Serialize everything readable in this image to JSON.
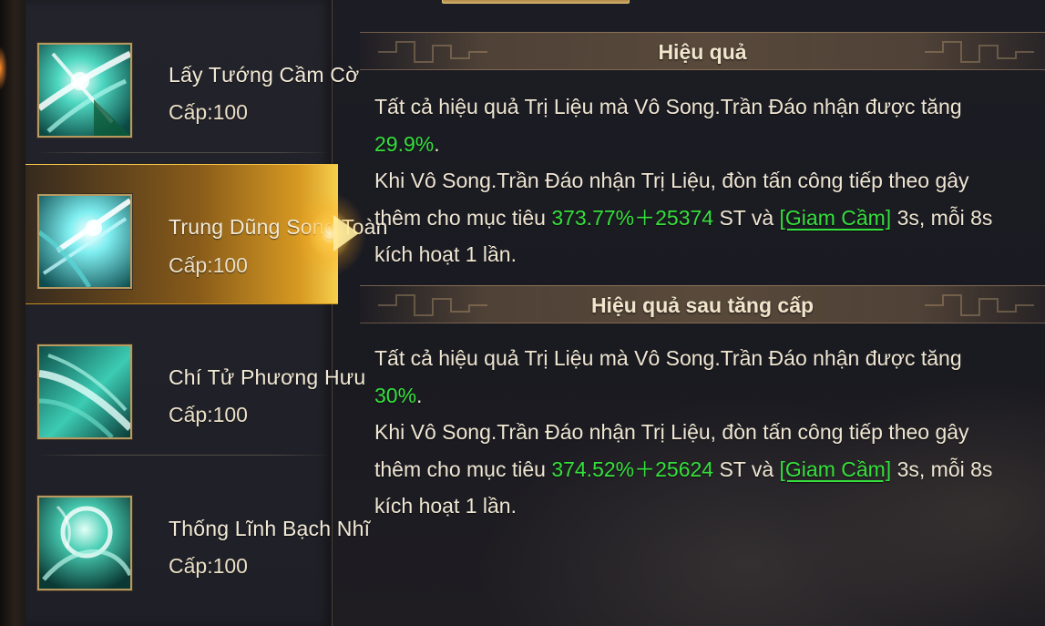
{
  "skills": [
    {
      "name": "Lấy Tướng Cầm Cờ",
      "level": "Cấp:100",
      "icon": "green-slash-icon",
      "selected": false
    },
    {
      "name": "Trung Dũng Song Toàn",
      "level": "Cấp:100",
      "icon": "ice-strike-icon",
      "selected": true
    },
    {
      "name": "Chí Tử Phương Hưu",
      "level": "Cấp:100",
      "icon": "wind-sweep-icon",
      "selected": false
    },
    {
      "name": "Thống Lĩnh Bạch Nhĩ",
      "level": "Cấp:100",
      "icon": "spirit-orb-icon",
      "selected": false
    }
  ],
  "current": {
    "title": "Hiệu quả",
    "p1": "Tất cả hiệu quả Trị Liệu mà Vô Song.Trần Đáo nhận được tăng ",
    "v1": "29.9%",
    "p2": ".",
    "p3": "Khi Vô Song.Trần Đáo nhận Trị Liệu, đòn tấn công tiếp theo gây thêm cho mục tiêu ",
    "v2": "373.77%＋25374",
    "p4": " ST và ",
    "status": "[Giam Cầm]",
    "p5": " 3s, mỗi 8s kích hoạt 1 lần."
  },
  "next": {
    "title": "Hiệu quả sau tăng cấp",
    "p1": "Tất cả hiệu quả Trị Liệu mà Vô Song.Trần Đáo nhận được tăng ",
    "v1": "30%",
    "p2": ".",
    "p3": "Khi Vô Song.Trần Đáo nhận Trị Liệu, đòn tấn công tiếp theo gây thêm cho mục tiêu ",
    "v2": "374.52%＋25624",
    "p4": " ST và ",
    "status": "[Giam Cầm]",
    "p5": " 3s, mỗi 8s kích hoạt 1 lần."
  },
  "colors": {
    "highlight_green": "#35e03c",
    "selected_gold": "#f2c246",
    "icon_frame": "#b79a62"
  }
}
